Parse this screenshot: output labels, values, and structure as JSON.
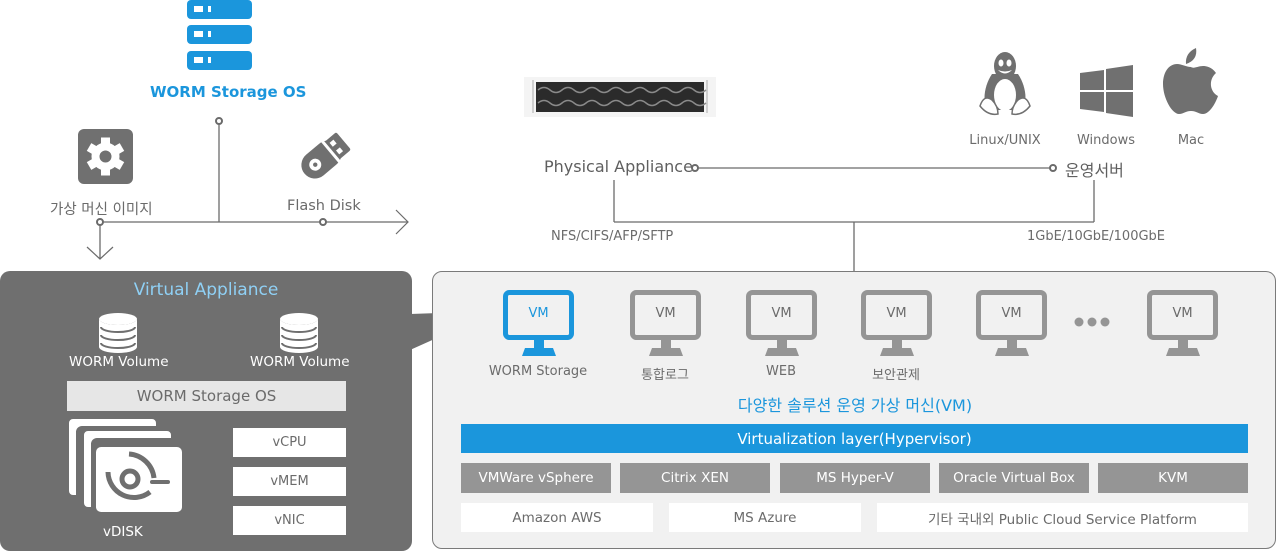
{
  "storage_os": {
    "title": "WORM Storage OS",
    "sources": [
      {
        "label": "가상 머신 이미지",
        "icon": "gear-icon"
      },
      {
        "label": "Flash Disk",
        "icon": "usb-drive-icon"
      }
    ]
  },
  "virtual_appliance": {
    "title": "Virtual Appliance",
    "volumes": [
      "WORM Volume",
      "WORM Volume"
    ],
    "os_label": "WORM Storage OS",
    "disk_label": "vDISK",
    "resources": [
      "vCPU",
      "vMEM",
      "vNIC"
    ]
  },
  "physical": {
    "label": "Physical Appliance",
    "protocols": "NFS/CIFS/AFP/SFTP"
  },
  "servers": {
    "label": "운영서버",
    "network": "1GbE/10GbE/100GbE",
    "os": [
      {
        "label": "Linux/UNIX",
        "icon": "linux-penguin-icon"
      },
      {
        "label": "Windows",
        "icon": "windows-icon"
      },
      {
        "label": "Mac",
        "icon": "apple-icon"
      }
    ]
  },
  "vm_panel": {
    "vms": [
      {
        "text": "VM",
        "label": "WORM Storage",
        "highlight": true
      },
      {
        "text": "VM",
        "label": "통합로그"
      },
      {
        "text": "VM",
        "label": "WEB"
      },
      {
        "text": "VM",
        "label": "보안관제"
      },
      {
        "text": "VM",
        "label": ""
      },
      {
        "text": "VM",
        "label": ""
      }
    ],
    "ellipsis": "•••",
    "title": "다양한 솔루션 운영 가상 머신(VM)",
    "hypervisor": "Virtualization layer(Hypervisor)",
    "hypervisors": [
      "VMWare vSphere",
      "Citrix XEN",
      "MS Hyper-V",
      "Oracle Virtual Box",
      "KVM"
    ],
    "clouds": [
      "Amazon AWS",
      "MS Azure",
      "기타 국내외 Public Cloud Service Platform"
    ]
  },
  "colors": {
    "accent": "#1b96dc",
    "panel_dark": "#6f6f6f",
    "icon_gray": "#707070",
    "vm_gray": "#959595",
    "panel_light": "#f1f1f1",
    "va_title": "#8fd0f5"
  }
}
